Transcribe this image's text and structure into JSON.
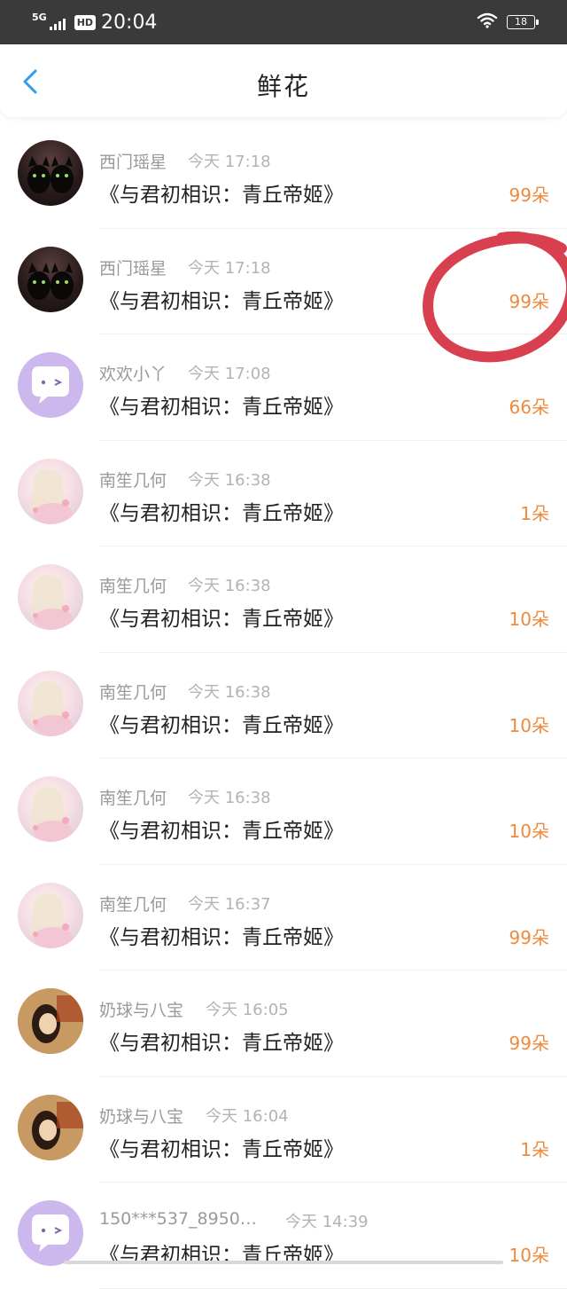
{
  "status_bar": {
    "network": "5G",
    "hd": "HD",
    "time": "20:04",
    "battery": "18"
  },
  "header": {
    "title": "鲜花"
  },
  "colors": {
    "count": "#ef8a3c",
    "name": "#9a9a9a",
    "annotation": "#d9404f"
  },
  "rows": [
    {
      "name": "西门瑶星",
      "time": "今天 17:18",
      "book": "《与君初相识：青丘帝姬》",
      "count": "99朵",
      "avatar": "cat-avatar"
    },
    {
      "name": "西门瑶星",
      "time": "今天 17:18",
      "book": "《与君初相识：青丘帝姬》",
      "count": "99朵",
      "avatar": "cat-avatar"
    },
    {
      "name": "欢欢小丫",
      "time": "今天 17:08",
      "book": "《与君初相识：青丘帝姬》",
      "count": "66朵",
      "avatar": "chat-bubble-avatar"
    },
    {
      "name": "南笙几何",
      "time": "今天 16:38",
      "book": "《与君初相识：青丘帝姬》",
      "count": "1朵",
      "avatar": "anime-girl-avatar"
    },
    {
      "name": "南笙几何",
      "time": "今天 16:38",
      "book": "《与君初相识：青丘帝姬》",
      "count": "10朵",
      "avatar": "anime-girl-avatar"
    },
    {
      "name": "南笙几何",
      "time": "今天 16:38",
      "book": "《与君初相识：青丘帝姬》",
      "count": "10朵",
      "avatar": "anime-girl-avatar"
    },
    {
      "name": "南笙几何",
      "time": "今天 16:38",
      "book": "《与君初相识：青丘帝姬》",
      "count": "10朵",
      "avatar": "anime-girl-avatar"
    },
    {
      "name": "南笙几何",
      "time": "今天 16:37",
      "book": "《与君初相识：青丘帝姬》",
      "count": "99朵",
      "avatar": "anime-girl-avatar"
    },
    {
      "name": "奶球与八宝",
      "time": "今天 16:05",
      "book": "《与君初相识：青丘帝姬》",
      "count": "99朵",
      "avatar": "photo-avatar"
    },
    {
      "name": "奶球与八宝",
      "time": "今天 16:04",
      "book": "《与君初相识：青丘帝姬》",
      "count": "1朵",
      "avatar": "photo-avatar"
    },
    {
      "name": "150***537_8950…",
      "time": "今天 14:39",
      "book": "《与君初相识：青丘帝姬》",
      "count": "10朵",
      "avatar": "chat-bubble-avatar"
    }
  ]
}
